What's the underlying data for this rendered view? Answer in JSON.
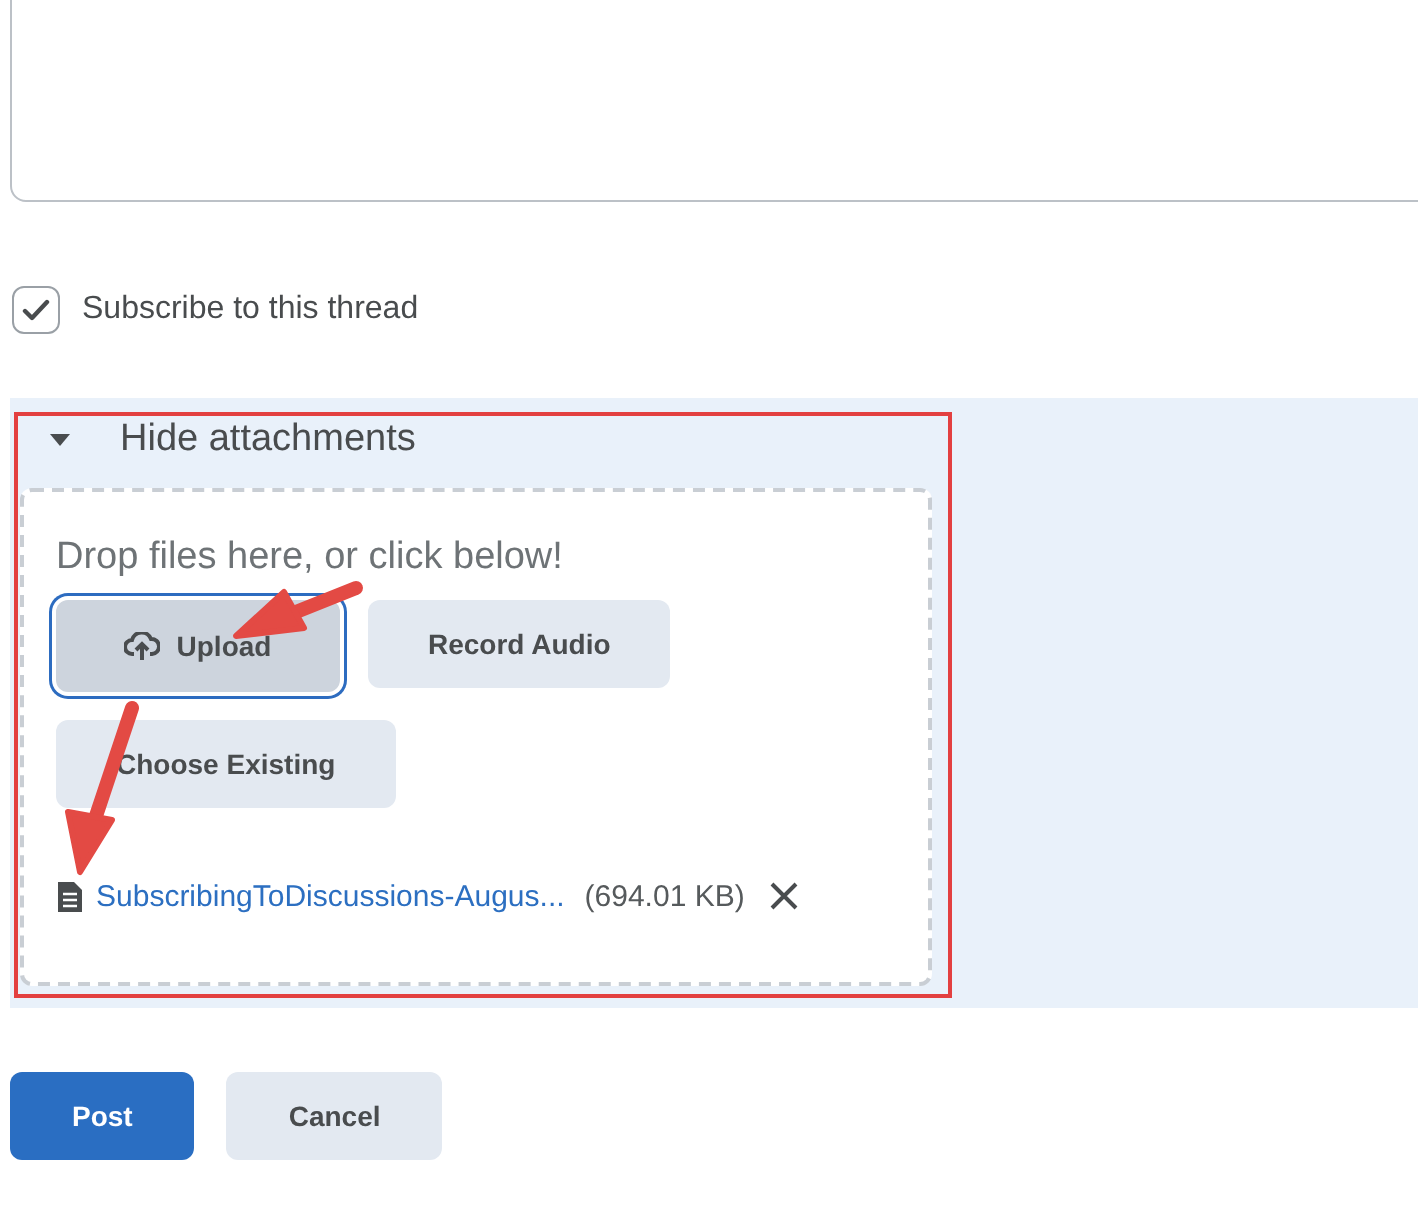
{
  "subscribe": {
    "label": "Subscribe to this thread",
    "checked": true
  },
  "attachments": {
    "toggle": "Hide attachments",
    "expanded": true,
    "drop_hint": "Drop files here, or click below!",
    "buttons": [
      {
        "label": "Upload",
        "kind": "upload",
        "focused": true
      },
      {
        "label": "Record Audio",
        "kind": "plain",
        "focused": false
      },
      {
        "label": "Choose Existing",
        "kind": "plain",
        "focused": false
      }
    ],
    "files": [
      {
        "name": "SubscribingToDiscussions-Augus...",
        "size": "(694.01 KB)"
      }
    ]
  },
  "actions": [
    {
      "label": "Post",
      "kind": "primary"
    },
    {
      "label": "Cancel",
      "kind": "secondary"
    }
  ]
}
